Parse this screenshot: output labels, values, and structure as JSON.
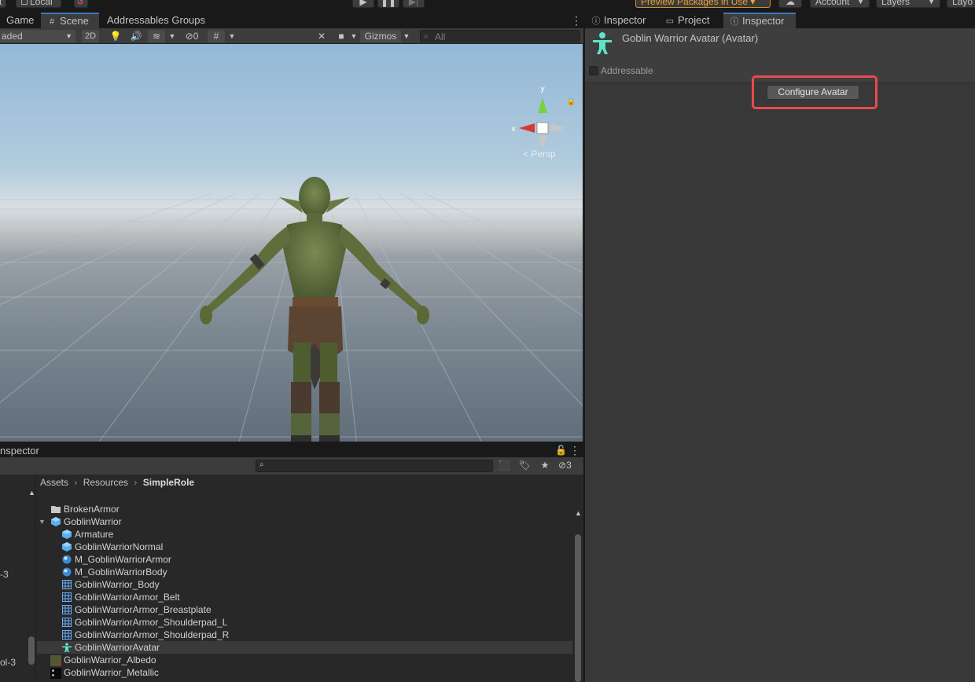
{
  "toolbar": {
    "left_fragment": "t",
    "local_label": "Local",
    "preview_packages": "Preview Packages in Use ▾",
    "account": "Account",
    "layers": "Layers",
    "layout": "Layo"
  },
  "left_tabs": [
    {
      "label": "Game",
      "icon": ""
    },
    {
      "label": "Scene",
      "icon": "#"
    },
    {
      "label": "Addressables Groups",
      "icon": ""
    }
  ],
  "scene_toolbar": {
    "shading": "aded",
    "mode_2d": "2D",
    "hidden_count": "0",
    "gizmos": "Gizmos",
    "search_placeholder": "All"
  },
  "scene_view": {
    "persp_label": "< Persp",
    "axis_y": "y",
    "axis_x": "x"
  },
  "bottom_panel": {
    "tab_label": "nspector",
    "visibility_count": "3",
    "left_tree_items": [
      "-3",
      "ol-3"
    ],
    "breadcrumb": [
      "Assets",
      "Resources",
      "SimpleRole"
    ],
    "files": [
      {
        "name": "BrokenArmor",
        "icon": "folder",
        "indent": 1
      },
      {
        "name": "GoblinWarrior",
        "icon": "prefab",
        "indent": 1,
        "expanded": true
      },
      {
        "name": "Armature",
        "icon": "prefab",
        "indent": 2
      },
      {
        "name": "GoblinWarriorNormal",
        "icon": "prefab",
        "indent": 2
      },
      {
        "name": "M_GoblinWarriorArmor",
        "icon": "material",
        "indent": 2
      },
      {
        "name": "M_GoblinWarriorBody",
        "icon": "material",
        "indent": 2
      },
      {
        "name": "GoblinWarrior_Body",
        "icon": "mesh",
        "indent": 2
      },
      {
        "name": "GoblinWarriorArmor_Belt",
        "icon": "mesh",
        "indent": 2
      },
      {
        "name": "GoblinWarriorArmor_Breastplate",
        "icon": "mesh",
        "indent": 2
      },
      {
        "name": "GoblinWarriorArmor_Shoulderpad_L",
        "icon": "mesh",
        "indent": 2
      },
      {
        "name": "GoblinWarriorArmor_Shoulderpad_R",
        "icon": "mesh",
        "indent": 2
      },
      {
        "name": "GoblinWarriorAvatar",
        "icon": "avatar",
        "indent": 2,
        "selected": true
      },
      {
        "name": "GoblinWarrior_Albedo",
        "icon": "texture",
        "indent": 1
      },
      {
        "name": "GoblinWarrior_Metallic",
        "icon": "texture-dark",
        "indent": 1
      }
    ]
  },
  "right_tabs": [
    {
      "label": "Inspector",
      "icon": "i"
    },
    {
      "label": "Project",
      "icon": "folder"
    },
    {
      "label": "Inspector",
      "icon": "i"
    }
  ],
  "inspector": {
    "title": "Goblin Warrior Avatar (Avatar)",
    "addressable_label": "Addressable",
    "configure_button": "Configure Avatar"
  },
  "colors": {
    "accent": "#3a79bb",
    "highlight": "#e84b4b",
    "preview_warning": "#e8a33a",
    "avatar_icon": "#5fe3c9"
  }
}
